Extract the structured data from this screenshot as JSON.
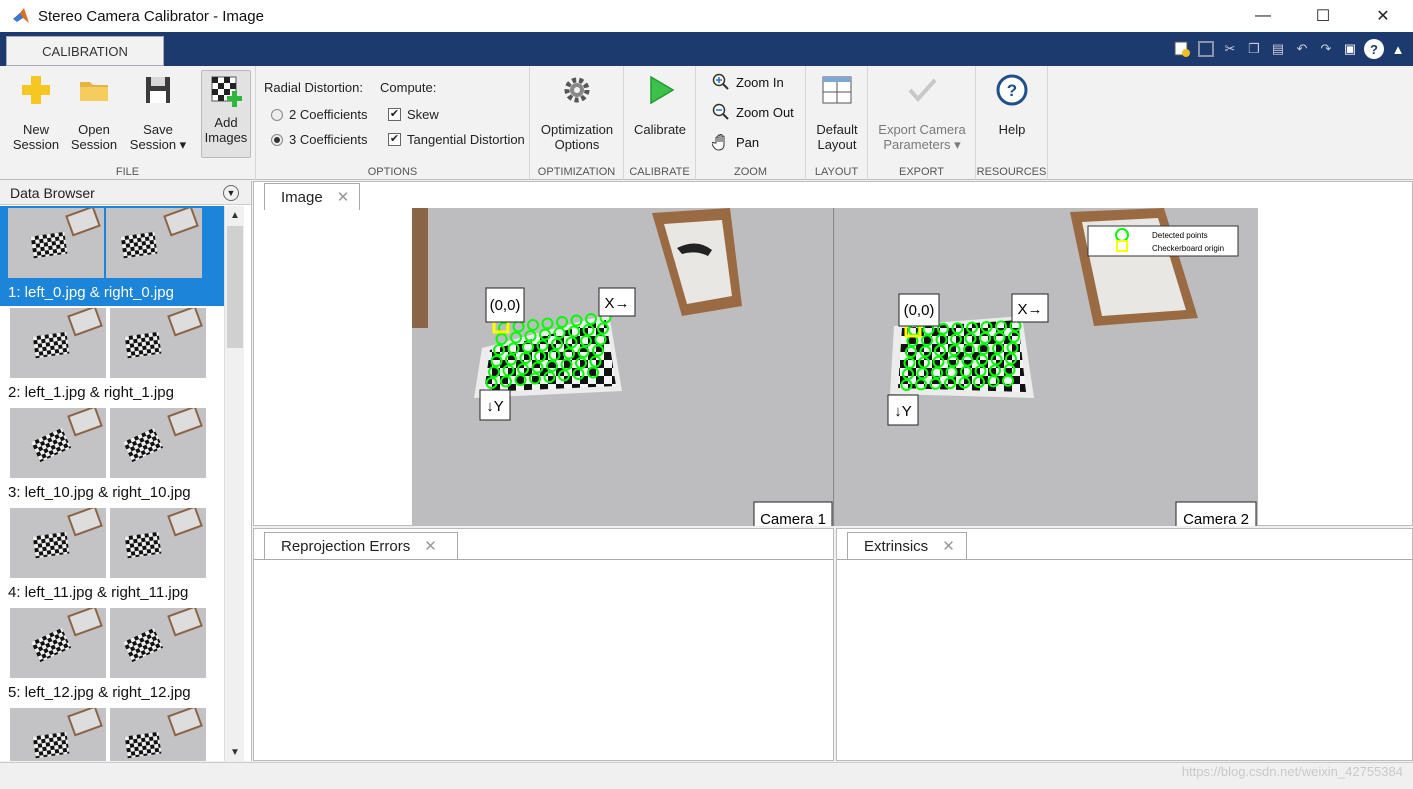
{
  "window": {
    "title": "Stereo Camera Calibrator - Image",
    "minimize": "—",
    "maximize": "☐",
    "close": "✕"
  },
  "ribbon_tab": "CALIBRATION",
  "file_group": {
    "label": "FILE",
    "new_session": [
      "New",
      "Session"
    ],
    "open_session": [
      "Open",
      "Session"
    ],
    "save_session": [
      "Save",
      "Session ▾"
    ],
    "add_images": [
      "Add",
      "Images"
    ]
  },
  "options_group": {
    "label": "OPTIONS",
    "radial_distortion": "Radial Distortion:",
    "coeff2": "2 Coefficients",
    "coeff3": "3 Coefficients",
    "compute": "Compute:",
    "skew": "Skew",
    "tangential": "Tangential Distortion"
  },
  "optimization_group": {
    "label": "OPTIMIZATION",
    "button": [
      "Optimization",
      "Options"
    ]
  },
  "calibrate_group": {
    "label": "CALIBRATE",
    "button": "Calibrate"
  },
  "zoom_group": {
    "label": "ZOOM",
    "zoom_in": "Zoom In",
    "zoom_out": "Zoom Out",
    "pan": "Pan"
  },
  "layout_group": {
    "label": "LAYOUT",
    "button": [
      "Default",
      "Layout"
    ]
  },
  "export_group": {
    "label": "EXPORT",
    "button": [
      "Export Camera",
      "Parameters ▾"
    ]
  },
  "resources_group": {
    "label": "RESOURCES",
    "button": "Help"
  },
  "data_browser": {
    "title": "Data Browser",
    "items": [
      "1: left_0.jpg & right_0.jpg",
      "2: left_1.jpg & right_1.jpg",
      "3: left_10.jpg & right_10.jpg",
      "4: left_11.jpg & right_11.jpg",
      "5: left_12.jpg & right_12.jpg",
      ""
    ],
    "selected_index": 0
  },
  "image_panel": {
    "tab": "Image",
    "close": "✕",
    "origin_label": "(0,0)",
    "x_axis_label": "X→",
    "y_axis_label": "↓Y",
    "camera1": "Camera 1",
    "camera2": "Camera 2",
    "legend_detected": "Detected points",
    "legend_origin": "Checkerboard origin"
  },
  "reprojection_panel": {
    "tab": "Reprojection Errors",
    "close": "✕"
  },
  "extrinsics_panel": {
    "tab": "Extrinsics",
    "close": "✕"
  },
  "watermark": "https://blog.csdn.net/weixin_42755384",
  "colors": {
    "title_bar_blue": "#1d3a6e",
    "selection_blue": "#1c84d9",
    "detected_green": "#00ff00",
    "origin_yellow": "#ffff00"
  }
}
